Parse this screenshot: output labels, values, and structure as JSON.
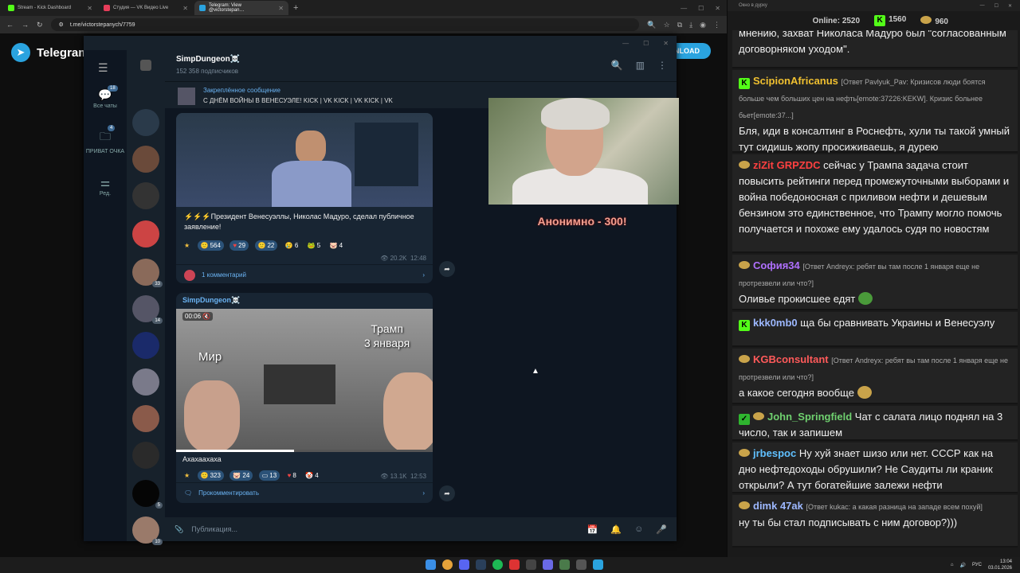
{
  "browser": {
    "tabs": [
      {
        "label": "Stream - Kick Dashboard",
        "color": "#53fc18"
      },
      {
        "label": "Студия — VK Видео Live",
        "color": "#e63d5a"
      },
      {
        "label": "Telegram: View @victorstepan…",
        "color": "#2aa3df"
      }
    ],
    "url": "t.me/victorstepanych/7759"
  },
  "telegram": {
    "logo_text": "Telegram",
    "download_label": "NLOAD",
    "folders": [
      {
        "label": "Все чаты",
        "badge": "18"
      },
      {
        "label": "ПРИВАТ ОЧКА",
        "badge": "4"
      },
      {
        "label": "Ред.",
        "badge": ""
      }
    ],
    "avatar_counts": [
      "33",
      "14",
      "5",
      "10"
    ],
    "channel": {
      "name": "SimpDungeon☠️",
      "subscribers": "152 358 подписчиков"
    },
    "pinned": {
      "title": "Закреплённое сообщение",
      "text": "С ДНЁМ ВОЙНЫ В ВЕНЕСУЭЛЕ! KICK | VK KICK | VK KICK | VK"
    },
    "post1": {
      "text": "⚡⚡⚡Президент Венесуэллы, Николас Мадуро, сделал публичное заявление!",
      "reactions": [
        "564",
        "29",
        "22",
        "6",
        "5",
        "4"
      ],
      "views": "20.2K",
      "time": "12:48",
      "comments": "1 комментарий"
    },
    "post2": {
      "author": "SimpDungeon☠️",
      "video_time": "00:06",
      "caption_left": "Мир",
      "caption_right": "Трамп\n3 января",
      "text": "Ахахаахаха",
      "reactions": [
        "323",
        "24",
        "13",
        "8",
        "4"
      ],
      "views": "13.1K",
      "time": "12:53",
      "comments": "Прокомментировать"
    },
    "input_placeholder": "Публикация..."
  },
  "overlay": {
    "anon_text": "Анонимно - 300!"
  },
  "chat": {
    "window_title": "Окно в дурку",
    "online_label": "Online:",
    "online": "2520",
    "kick_count": "1560",
    "vk_count": "960",
    "messages": [
      {
        "user": "",
        "reply": "",
        "text": "мнению, захват Николаса Мадуро был \"согласованным договорняком уходом\"."
      },
      {
        "user": "ScipionAfricanus",
        "color": "#f0c030",
        "reply": "[Ответ Pavlyuk_Pav: Кризисов люди боятся больше чем больших цен на нефть[emote:37226:KEKW]. Кризис больнее бьет[emote:37...]",
        "text": "Бля, иди в консалтинг в Роснефть, хули ты такой умный тут сидишь жопу просиживаешь, я дурею"
      },
      {
        "user": "ziZit",
        "color": "#ff4040",
        "user2": "GRPZDC",
        "reply": "",
        "text": "сейчас у Трампа задача стоит повысить рейтинги перед промежуточными выборами и война победоносная с приливом нефти и дешевым бензином это единственное, что Трампу могло помочь получается и похоже ему удалось судя по новостям"
      },
      {
        "user": "София34",
        "color": "#b070ff",
        "reply": "[Ответ Andreyx: ребят вы там после 1 января еще не протрезвели или что?]",
        "text": "Оливье прокисшее едят"
      },
      {
        "user": "kkk0mb0",
        "color": "#9db8ff",
        "reply": "",
        "text": "ща бы сравнивать Украины и Венесуэлу"
      },
      {
        "user": "KGBconsultant",
        "color": "#ff5a5a",
        "reply": "[Ответ Andreyx: ребят вы там после 1 января еще не протрезвели или что?]",
        "text": "а какое сегодня вообще"
      },
      {
        "user": "John_Springfield",
        "color": "#6fd06f",
        "reply": "",
        "text": "Чат с салата лицо поднял на 3 число, так и запишем"
      },
      {
        "user": "jrbespoc",
        "color": "#60c0ff",
        "reply": "",
        "text": "Ну хуй знает шизо или нет. СССР как на дно нефтедоходы обрушили? Не Саудиты ли краник открыли? А тут богатейшие залежи нефти"
      },
      {
        "user": "dimk 47ak",
        "color": "#9db8ff",
        "reply": "[Ответ kukac: а какая разница на западе всем похуй]",
        "text": "ну ты бы стал подписывать с ним договор?)))"
      }
    ]
  },
  "taskbar": {
    "lang": "РУС",
    "time": "13:04",
    "date": "03.01.2026"
  }
}
